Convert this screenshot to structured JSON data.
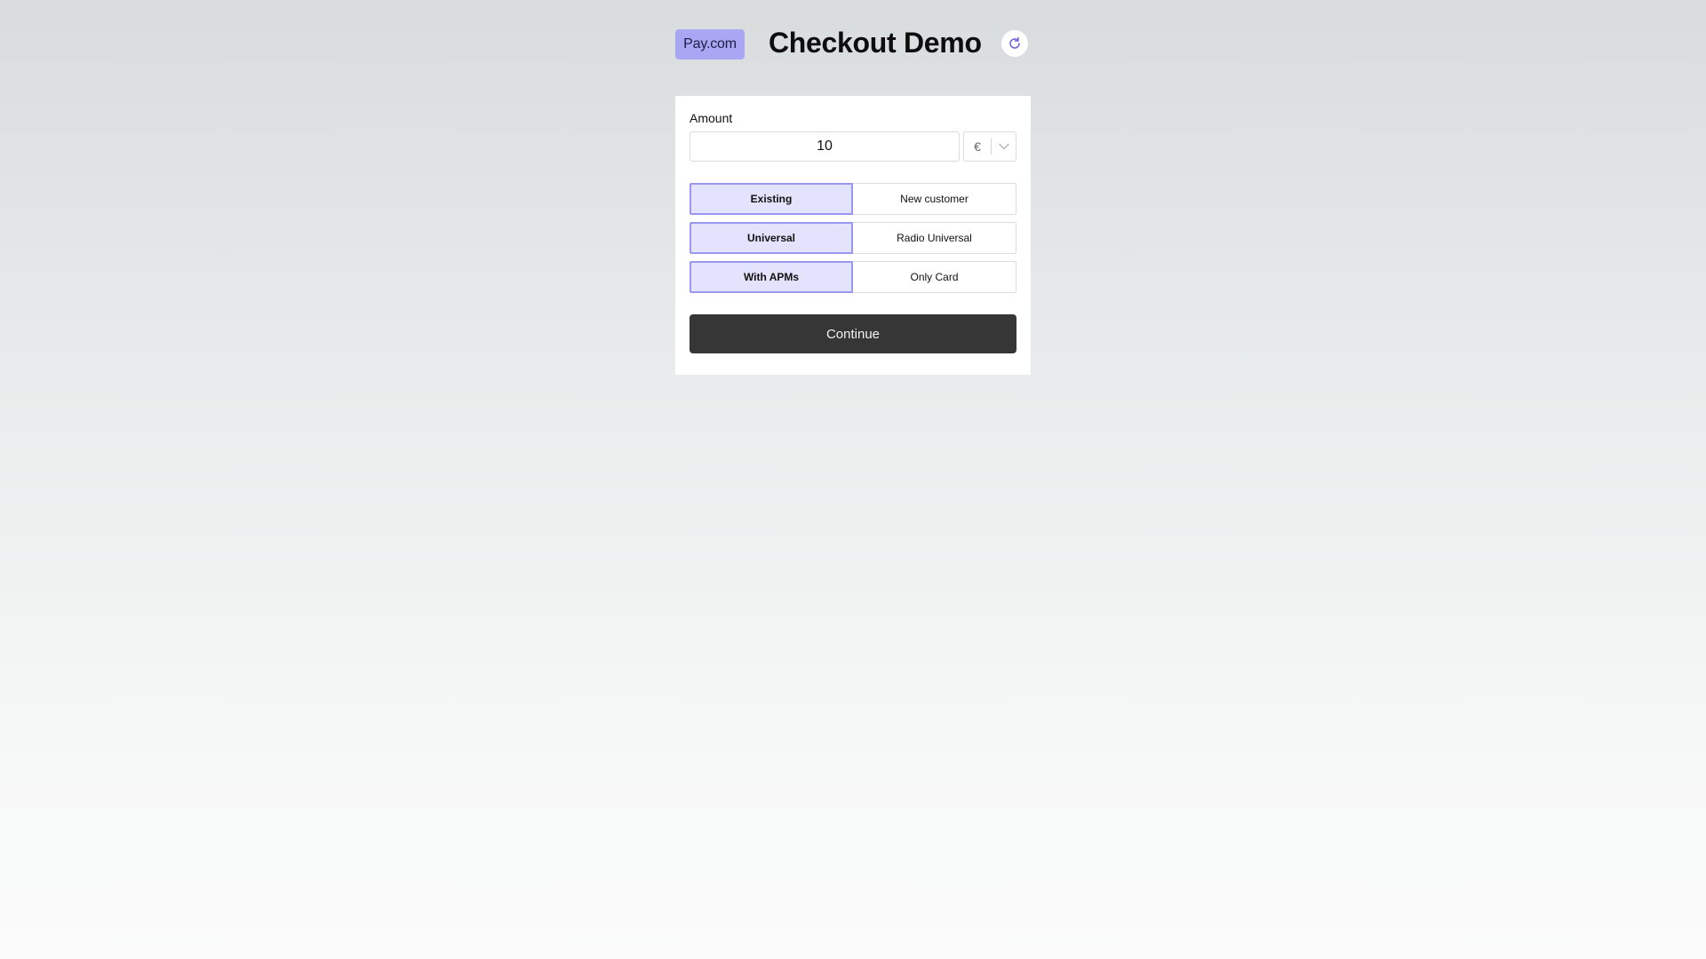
{
  "header": {
    "logo_text": "Pay.com",
    "title": "Checkout Demo",
    "refresh_icon": "refresh-icon"
  },
  "form": {
    "amount_label": "Amount",
    "amount_value": "10",
    "currency": {
      "selected": "€",
      "icon": "chevron-down-icon"
    },
    "toggles": [
      {
        "active": "Existing",
        "inactive": "New customer"
      },
      {
        "active": "Universal",
        "inactive": "Radio Universal"
      },
      {
        "active": "With APMs",
        "inactive": "Only Card"
      }
    ],
    "continue_label": "Continue"
  },
  "colors": {
    "brand": "#a9a6f3",
    "active_toggle_bg": "#e4e3fd",
    "active_toggle_border": "#9a97ee",
    "primary_button": "#363636",
    "refresh_icon": "#6a67d8"
  }
}
